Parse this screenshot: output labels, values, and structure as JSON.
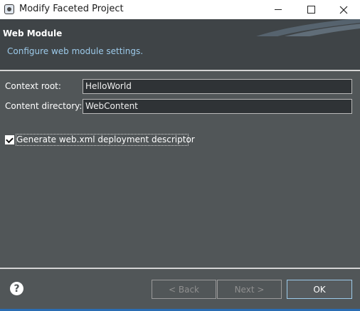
{
  "window": {
    "title": "Modify Faceted Project",
    "icons": {
      "app": "eclipse-app-icon",
      "minimize": "minimize-icon",
      "maximize": "maximize-icon",
      "close": "close-icon"
    }
  },
  "header": {
    "title": "Web Module",
    "description": "Configure web module settings."
  },
  "form": {
    "context_root_label": "Context root:",
    "context_root_value": "HelloWorld",
    "content_dir_label": "Content directory:",
    "content_dir_value": "WebContent",
    "generate_label": "Generate web.xml deployment descriptor",
    "generate_checked": true
  },
  "footer": {
    "help_icon": "question-mark",
    "back_label": "< Back",
    "next_label": "Next >",
    "ok_label": "OK"
  },
  "colors": {
    "background": "#515658",
    "header_background": "#3f4447",
    "description_text": "#9ccaea",
    "focus_border": "#9ccaea",
    "disabled_text": "#8f8f8f"
  }
}
